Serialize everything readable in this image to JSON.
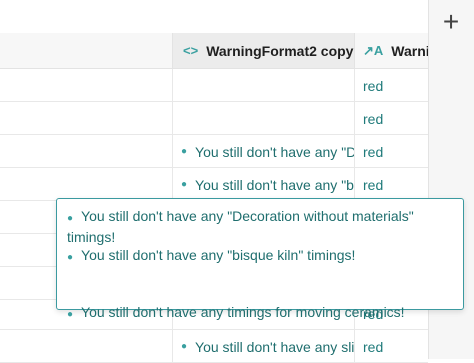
{
  "header": {
    "col1_label": "WarningFormat2 copy",
    "col2_label": "Warnir",
    "col1_icon": "code-icon",
    "col2_icon": "text-format-icon"
  },
  "add_button_label": "+",
  "rows": [
    {
      "c1": "",
      "c2": "red"
    },
    {
      "c1": "",
      "c2": "red"
    },
    {
      "c1": "You still don't have any \"D",
      "c2": "red"
    },
    {
      "c1": "You still don't have any \"b",
      "c2": "red"
    },
    {
      "c1": "",
      "c2": ""
    },
    {
      "c1": "",
      "c2": ""
    },
    {
      "c1": "",
      "c2": ""
    },
    {
      "c1": "",
      "c2": "red"
    },
    {
      "c1": "You still don't have any slip ca",
      "c2": "red"
    }
  ],
  "tooltip": {
    "line1": "You still don't have any \"Decoration without materials\" timings!",
    "line2": "You still don't have any \"bisque kiln\" timings!",
    "line3": "You still don't have any timings for moving ceramics!"
  }
}
